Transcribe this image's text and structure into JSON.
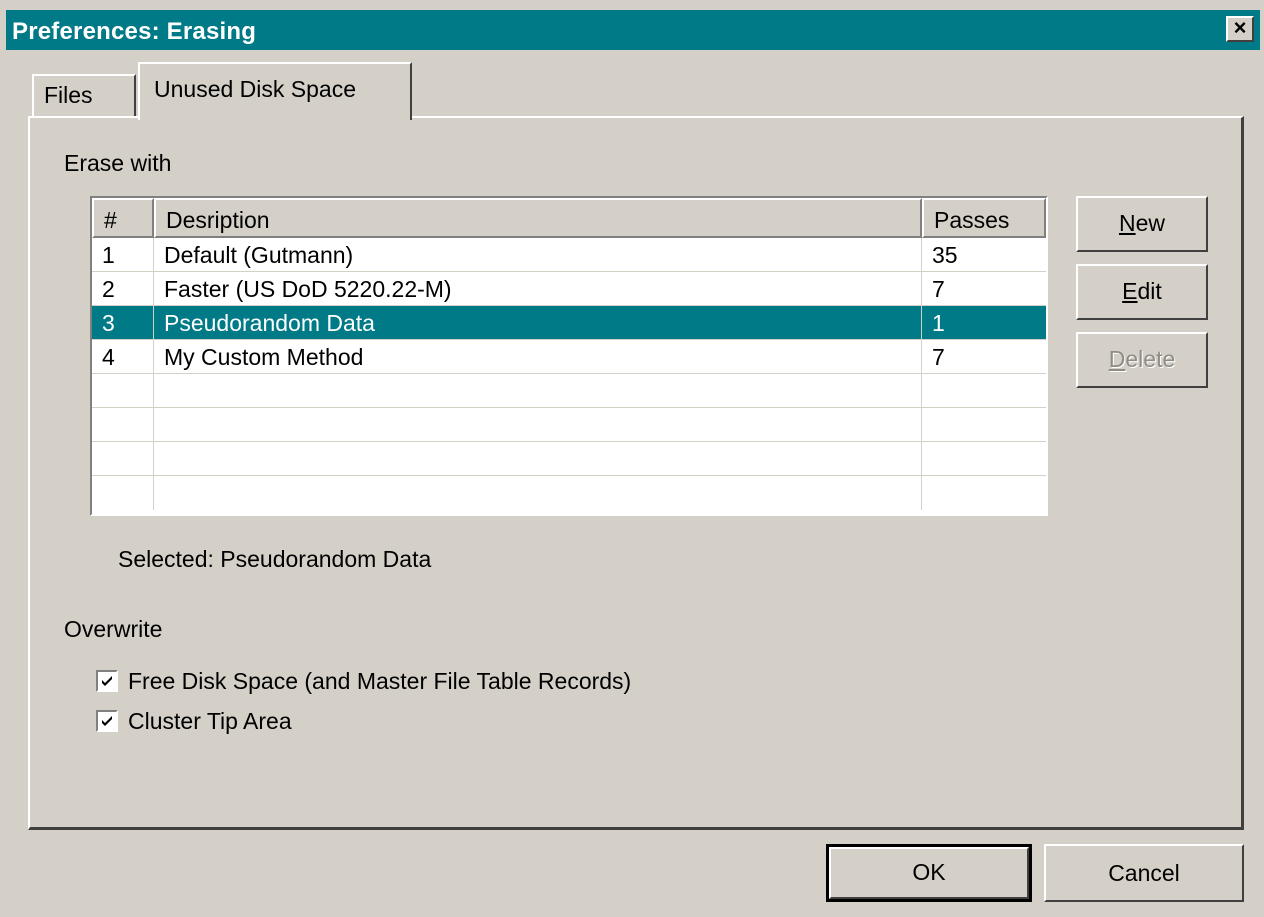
{
  "window": {
    "title": "Preferences: Erasing",
    "close_label": "×"
  },
  "tabs": [
    {
      "label": "Files",
      "active": false
    },
    {
      "label": "Unused Disk Space",
      "active": true
    }
  ],
  "erase_with_label": "Erase with",
  "list": {
    "headers": [
      "#",
      "Desription",
      "Passes"
    ],
    "rows": [
      {
        "num": "1",
        "description": "Default (Gutmann)",
        "passes": "35",
        "selected": false
      },
      {
        "num": "2",
        "description": "Faster (US DoD 5220.22-M)",
        "passes": "7",
        "selected": false
      },
      {
        "num": "3",
        "description": "Pseudorandom Data",
        "passes": "1",
        "selected": true
      },
      {
        "num": "4",
        "description": "My Custom Method",
        "passes": "7",
        "selected": false
      }
    ]
  },
  "buttons": {
    "new": {
      "pre": "",
      "accel": "N",
      "post": "ew"
    },
    "edit": {
      "pre": "",
      "accel": "E",
      "post": "dit"
    },
    "delete": {
      "pre": "",
      "accel": "D",
      "post": "elete"
    },
    "ok": "OK",
    "cancel": "Cancel"
  },
  "selected_text": "Selected: Pseudorandom Data",
  "overwrite": {
    "label": "Overwrite",
    "options": [
      {
        "label": "Free Disk Space (and Master File Table Records)",
        "checked": true
      },
      {
        "label": "Cluster Tip Area",
        "checked": true
      }
    ]
  }
}
